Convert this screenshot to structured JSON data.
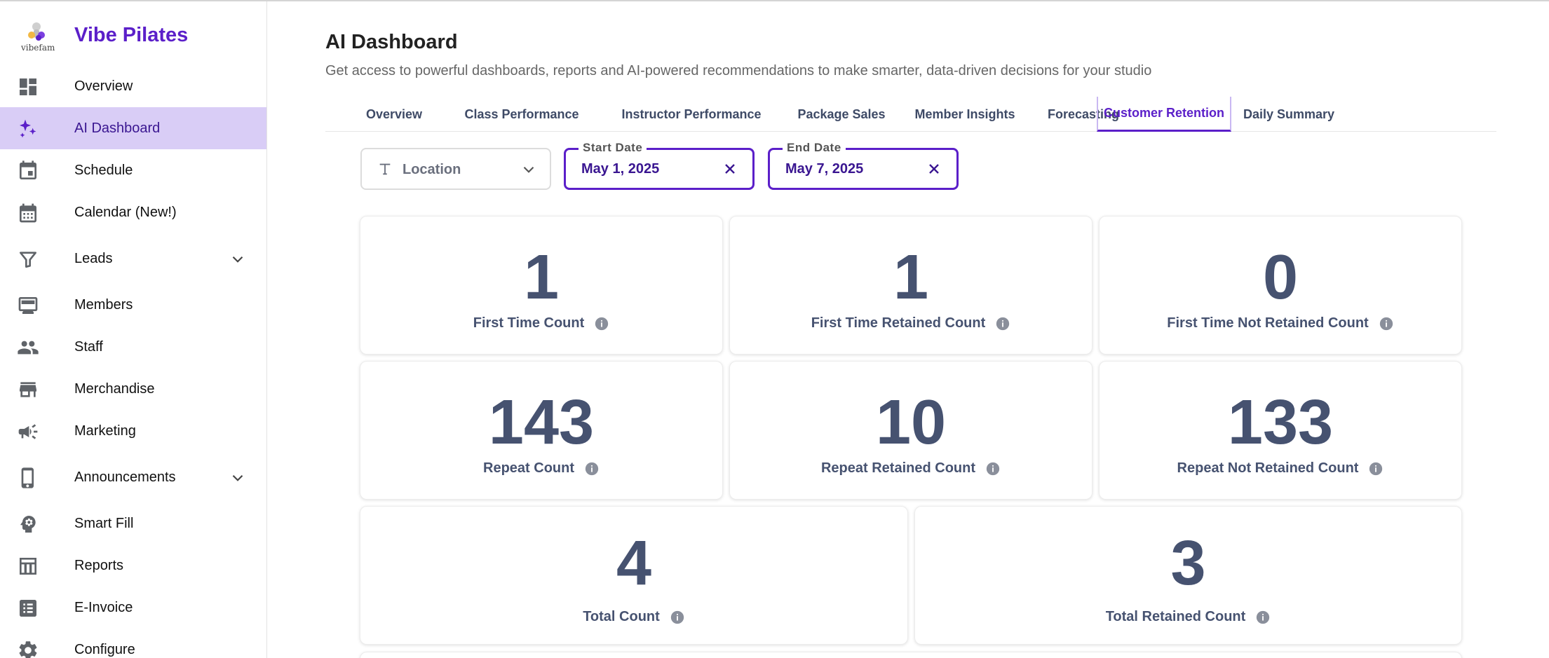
{
  "brand": {
    "name": "Vibe Pilates",
    "logo_text": "vibefam",
    "accent": "#5b1fc9"
  },
  "sidebar": {
    "items": [
      {
        "label": "Overview",
        "icon": "dashboard-icon"
      },
      {
        "label": "AI Dashboard",
        "icon": "sparkles-icon",
        "active": true
      },
      {
        "label": "Schedule",
        "icon": "calendar-event-icon"
      },
      {
        "label": "Calendar (New!)",
        "icon": "calendar-month-icon"
      },
      {
        "label": "Leads",
        "icon": "filter-icon",
        "expandable": true
      },
      {
        "label": "Members",
        "icon": "members-icon"
      },
      {
        "label": "Staff",
        "icon": "people-icon"
      },
      {
        "label": "Merchandise",
        "icon": "store-icon"
      },
      {
        "label": "Marketing",
        "icon": "megaphone-icon"
      },
      {
        "label": "Announcements",
        "icon": "phone-icon",
        "expandable": true
      },
      {
        "label": "Smart Fill",
        "icon": "psychology-icon"
      },
      {
        "label": "Reports",
        "icon": "table-icon"
      },
      {
        "label": "E-Invoice",
        "icon": "invoice-icon"
      },
      {
        "label": "Configure",
        "icon": "gear-icon"
      }
    ]
  },
  "header": {
    "title": "AI Dashboard",
    "subtitle": "Get access to powerful dashboards, reports and AI-powered recommendations to make smarter, data-driven decisions for your studio"
  },
  "tabs": [
    {
      "label": "Overview"
    },
    {
      "label": "Class Performance"
    },
    {
      "label": "Instructor Performance"
    },
    {
      "label": "Package Sales"
    },
    {
      "label": "Member Insights"
    },
    {
      "label": "Forecasting"
    },
    {
      "label": "Customer Retention",
      "active": true
    },
    {
      "label": "Daily Summary"
    }
  ],
  "filters": {
    "location_label": "Location",
    "start_date_label": "Start Date",
    "start_date_value": "May 1, 2025",
    "end_date_label": "End Date",
    "end_date_value": "May 7, 2025"
  },
  "metrics": [
    {
      "value": "1",
      "label": "First Time Count"
    },
    {
      "value": "1",
      "label": "First Time Retained Count"
    },
    {
      "value": "0",
      "label": "First Time Not Retained Count"
    },
    {
      "value": "143",
      "label": "Repeat Count"
    },
    {
      "value": "10",
      "label": "Repeat Retained Count"
    },
    {
      "value": "133",
      "label": "Repeat Not Retained Count"
    },
    {
      "value": "4",
      "label": "Total Count"
    },
    {
      "value": "3",
      "label": "Total Retained Count"
    }
  ]
}
